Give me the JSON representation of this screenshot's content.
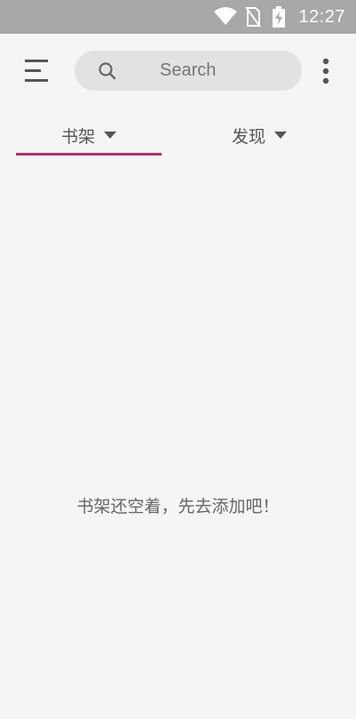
{
  "status_bar": {
    "time": "12:27",
    "icons": [
      "wifi-icon",
      "no-sim-icon",
      "battery-charging-icon"
    ]
  },
  "app_bar": {
    "menu_icon": "menu-icon",
    "search": {
      "placeholder": "Search",
      "icon": "search-icon"
    },
    "overflow_icon": "more-vert-icon"
  },
  "tabs": [
    {
      "label": "书架",
      "selected": true,
      "icon": "caret-down-icon"
    },
    {
      "label": "发现",
      "selected": false,
      "icon": "caret-down-icon"
    }
  ],
  "empty_state": {
    "message": "书架还空着，先去添加吧！"
  },
  "colors": {
    "status_bar": "#a8a8a8",
    "background": "#f5f5f5",
    "search_background": "#e2e2e2",
    "accent": "#b0336a"
  }
}
